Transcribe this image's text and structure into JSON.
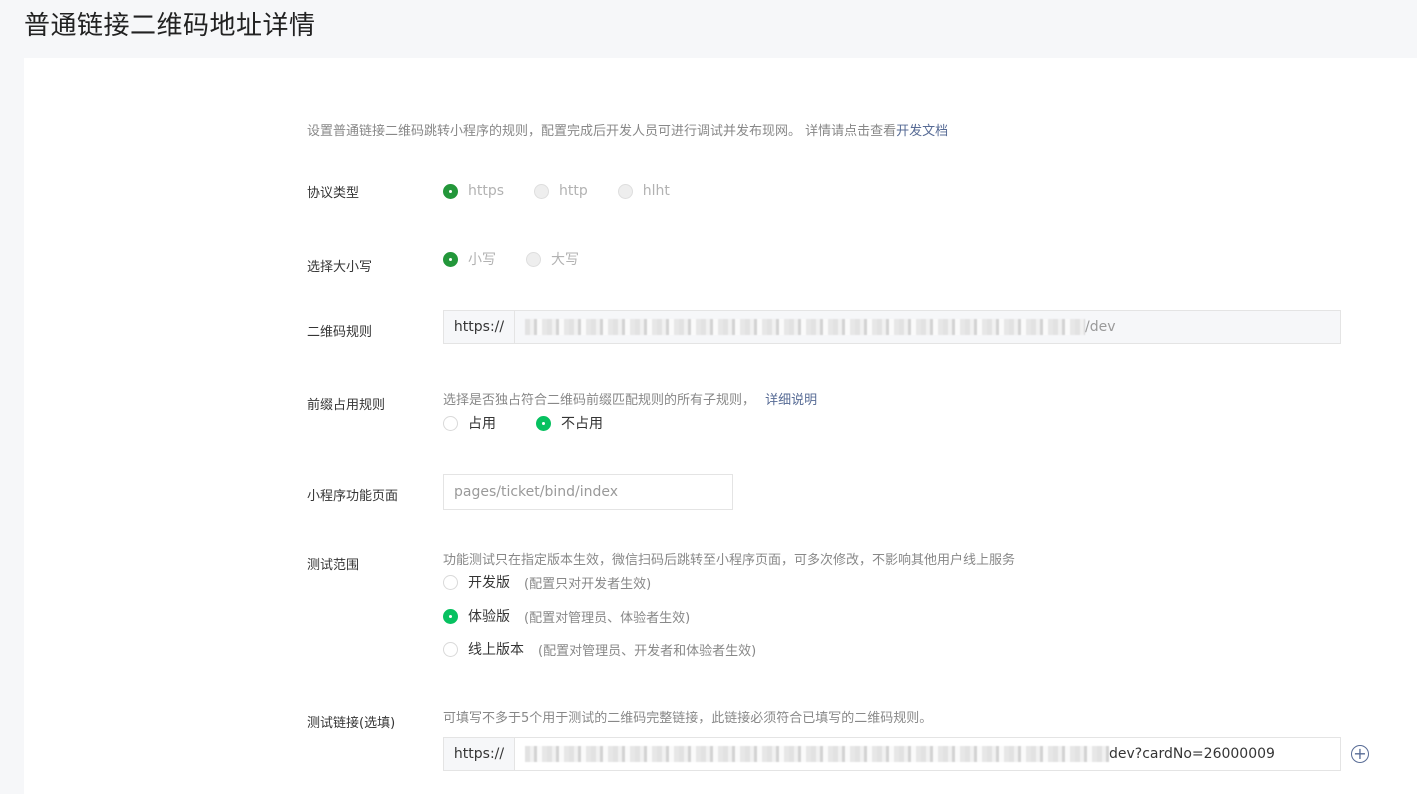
{
  "page": {
    "title": "普通链接二维码地址详情"
  },
  "intro": {
    "text": "设置普通链接二维码跳转小程序的规则，配置完成后开发人员可进行调试并发布现网。 详情请点击查看",
    "link": "开发文档"
  },
  "protocol": {
    "label": "协议类型",
    "options": [
      "https",
      "http",
      "hlht"
    ],
    "selected": "https"
  },
  "case": {
    "label": "选择大小写",
    "options": [
      "小写",
      "大写"
    ],
    "selected": "小写"
  },
  "qr_rule": {
    "label": "二维码规则",
    "prefix": "https://",
    "value_suffix": "/dev"
  },
  "prefix_rule": {
    "label": "前缀占用规则",
    "desc": "选择是否独占符合二维码前缀匹配规则的所有子规则，",
    "link": "详细说明",
    "options": [
      "占用",
      "不占用"
    ],
    "selected": "不占用"
  },
  "page_path": {
    "label": "小程序功能页面",
    "value": "pages/ticket/bind/index"
  },
  "test_scope": {
    "label": "测试范围",
    "desc": "功能测试只在指定版本生效，微信扫码后跳转至小程序页面，可多次修改，不影响其他用户线上服务",
    "options": [
      {
        "label": "开发版",
        "hint": "(配置只对开发者生效)"
      },
      {
        "label": "体验版",
        "hint": "(配置对管理员、体验者生效)"
      },
      {
        "label": "线上版本",
        "hint": "(配置对管理员、开发者和体验者生效)"
      }
    ],
    "selected": "体验版"
  },
  "test_link": {
    "label": "测试链接(选填)",
    "desc": "可填写不多于5个用于测试的二维码完整链接，此链接必须符合已填写的二维码规则。",
    "prefix": "https://",
    "value_suffix": "dev?cardNo=26000009",
    "add_icon": "plus-circle-icon"
  }
}
